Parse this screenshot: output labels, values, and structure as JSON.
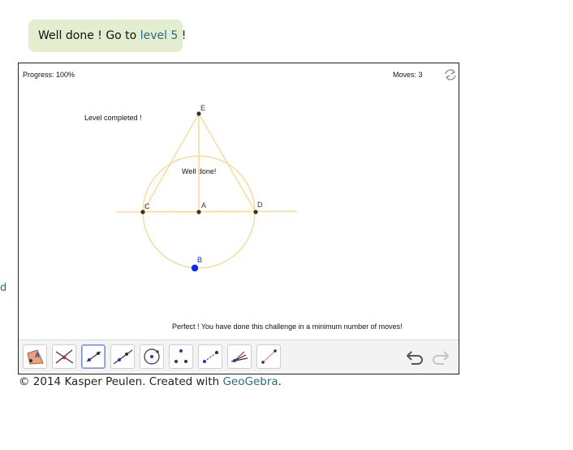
{
  "banner": {
    "prefix": "Well done ! Go to ",
    "link_text": "level 5",
    "suffix": " !"
  },
  "edge_text": "d",
  "applet": {
    "progress": "Progress: 100%",
    "moves": "Moves: 3",
    "level_completed": "Level completed !",
    "well_done": "Well done!",
    "perfect_message": "Perfect ! You have done this challenge in a minimum number of moves!",
    "points": {
      "E": "E",
      "C": "C",
      "A": "A",
      "D": "D",
      "B": "B"
    },
    "colors": {
      "construction": "#f6d58a",
      "point": "#333333",
      "free_point": "#0a2be0"
    },
    "tools": [
      "move-tool",
      "intersect-tool",
      "line-tool",
      "line-through-points-tool",
      "circle-with-center-tool",
      "point-tool",
      "segment-tool",
      "perpendicular-line-tool",
      "ray-tool"
    ],
    "selected_tool": "line-tool"
  },
  "footer": {
    "prefix": "© 2014 Kasper Peulen. Created with ",
    "link_text": "GeoGebra",
    "suffix": "."
  }
}
